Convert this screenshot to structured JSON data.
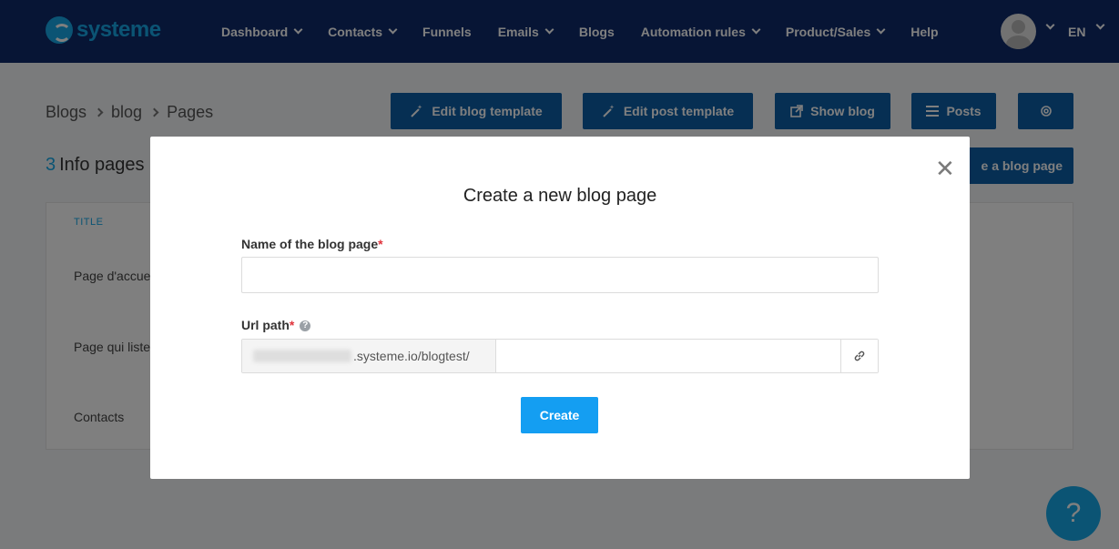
{
  "app": {
    "logo_text": "systeme",
    "brand_color": "#17a9e8",
    "nav_bg": "#0e2a6b"
  },
  "nav": {
    "items": [
      {
        "label": "Dashboard",
        "has_dropdown": true
      },
      {
        "label": "Contacts",
        "has_dropdown": true
      },
      {
        "label": "Funnels",
        "has_dropdown": false
      },
      {
        "label": "Emails",
        "has_dropdown": true
      },
      {
        "label": "Blogs",
        "has_dropdown": false
      },
      {
        "label": "Automation rules",
        "has_dropdown": true
      },
      {
        "label": "Product/Sales",
        "has_dropdown": true
      },
      {
        "label": "Help",
        "has_dropdown": false
      }
    ],
    "language": "EN"
  },
  "breadcrumb": [
    "Blogs",
    "blog",
    "Pages"
  ],
  "toolbar": {
    "edit_blog_template": "Edit blog template",
    "edit_post_template": "Edit post template",
    "show_blog": "Show blog",
    "posts": "Posts",
    "settings_icon": "gear-icon"
  },
  "page": {
    "count": "3",
    "count_label": "Info pages",
    "create_page_partial": "e a blog page",
    "table_header_title": "TITLE",
    "rows": [
      "Page d'accue",
      "Page qui liste",
      "Contacts"
    ]
  },
  "modal": {
    "title": "Create a new blog page",
    "name_label": "Name of the blog page",
    "name_value": "",
    "url_label": "Url path",
    "required_mark": "*",
    "help_icon": "question-icon",
    "url_prefix": ".systeme.io/blogtest/",
    "url_value": "",
    "create_label": "Create",
    "accent": "#149ef2"
  },
  "help": {
    "fab_label": "?"
  }
}
